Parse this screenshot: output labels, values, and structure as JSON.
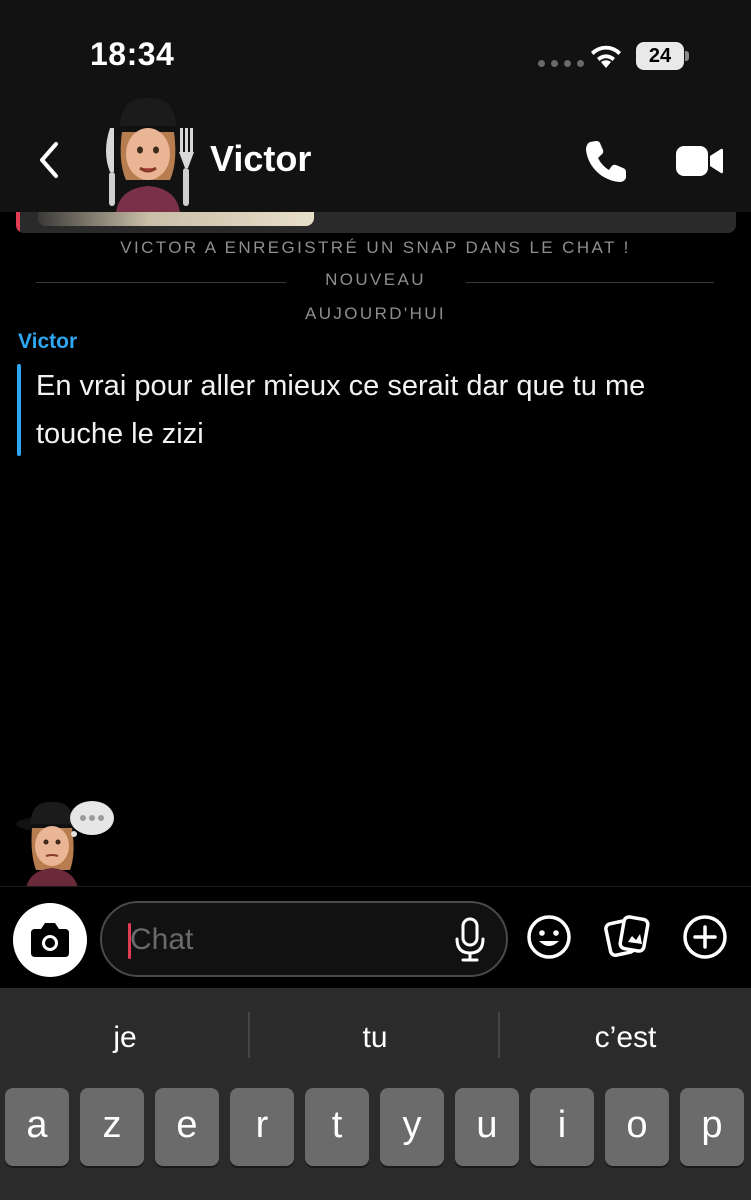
{
  "status_bar": {
    "time": "18:34",
    "battery": "24"
  },
  "header": {
    "contact_name": "Victor"
  },
  "chat": {
    "system_saved": "VICTOR A ENREGISTRÉ UN SNAP DANS LE CHAT !",
    "new_label": "NOUVEAU",
    "day_label": "AUJOURD'HUI",
    "messages": [
      {
        "sender": "Victor",
        "text": "En vrai pour aller mieux ce serait dar que tu me touche le zizi"
      }
    ]
  },
  "input": {
    "placeholder": "Chat"
  },
  "keyboard": {
    "suggestions": [
      "je",
      "tu",
      "c’est"
    ],
    "row1": [
      "a",
      "z",
      "e",
      "r",
      "t",
      "y",
      "u",
      "i",
      "o",
      "p"
    ]
  },
  "colors": {
    "accent_blue": "#2ea7f2",
    "accent_red": "#e23b54",
    "background": "#000000",
    "header_bg": "#121212"
  },
  "icons": [
    "back-chevron-icon",
    "phone-icon",
    "video-camera-icon",
    "camera-icon",
    "microphone-icon",
    "emoji-icon",
    "memories-icon",
    "plus-icon"
  ]
}
